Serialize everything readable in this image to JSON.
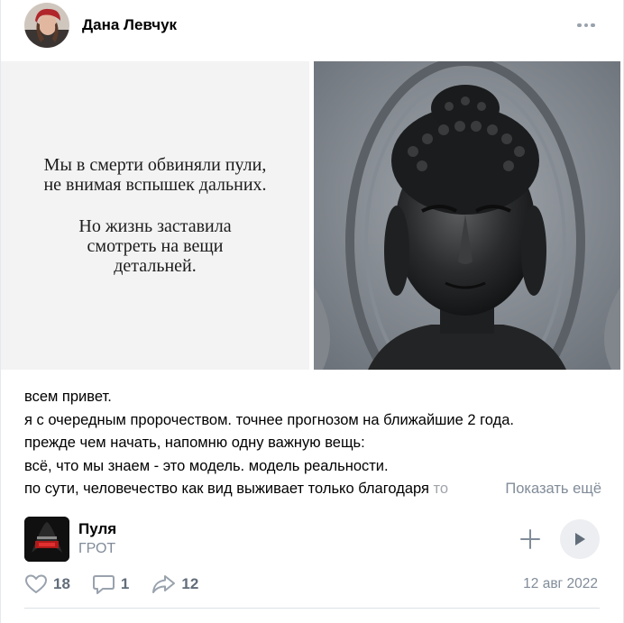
{
  "post": {
    "author": "Дана Левчук",
    "avatar_icon": "user-avatar-photo",
    "more_icon": "more-horizontal-icon",
    "image_quote": {
      "stanza1": [
        "Мы в смерти обвиняли пули,",
        "не внимая вспышек дальних."
      ],
      "stanza2": [
        "Но жизнь заставила",
        "смотреть на вещи",
        "детальней."
      ]
    },
    "image_right_icon": "buddha-statue-photo",
    "text_lines": [
      "всем привет.",
      "я с очередным пророчеством. точнее прогнозом на ближайшие 2 года.",
      "прежде чем начать, напомню одну важную вещь:",
      "всё, что мы знаем - это модель. модель реальности."
    ],
    "last_line_visible": "по сути, человечество как вид выживает только благодаря ",
    "last_line_fade": "то",
    "show_more": "Показать ещё",
    "audio": {
      "title": "Пуля",
      "artist": "ГРОТ",
      "cover_icon": "album-cover",
      "add_icon": "plus-icon",
      "play_icon": "play-icon"
    },
    "likes": "18",
    "comments": "1",
    "shares": "12",
    "date": "12 авг 2022"
  },
  "colors": {
    "secondary": "#818c99",
    "counter": "#626d7a",
    "play_bg": "#eceef1"
  }
}
